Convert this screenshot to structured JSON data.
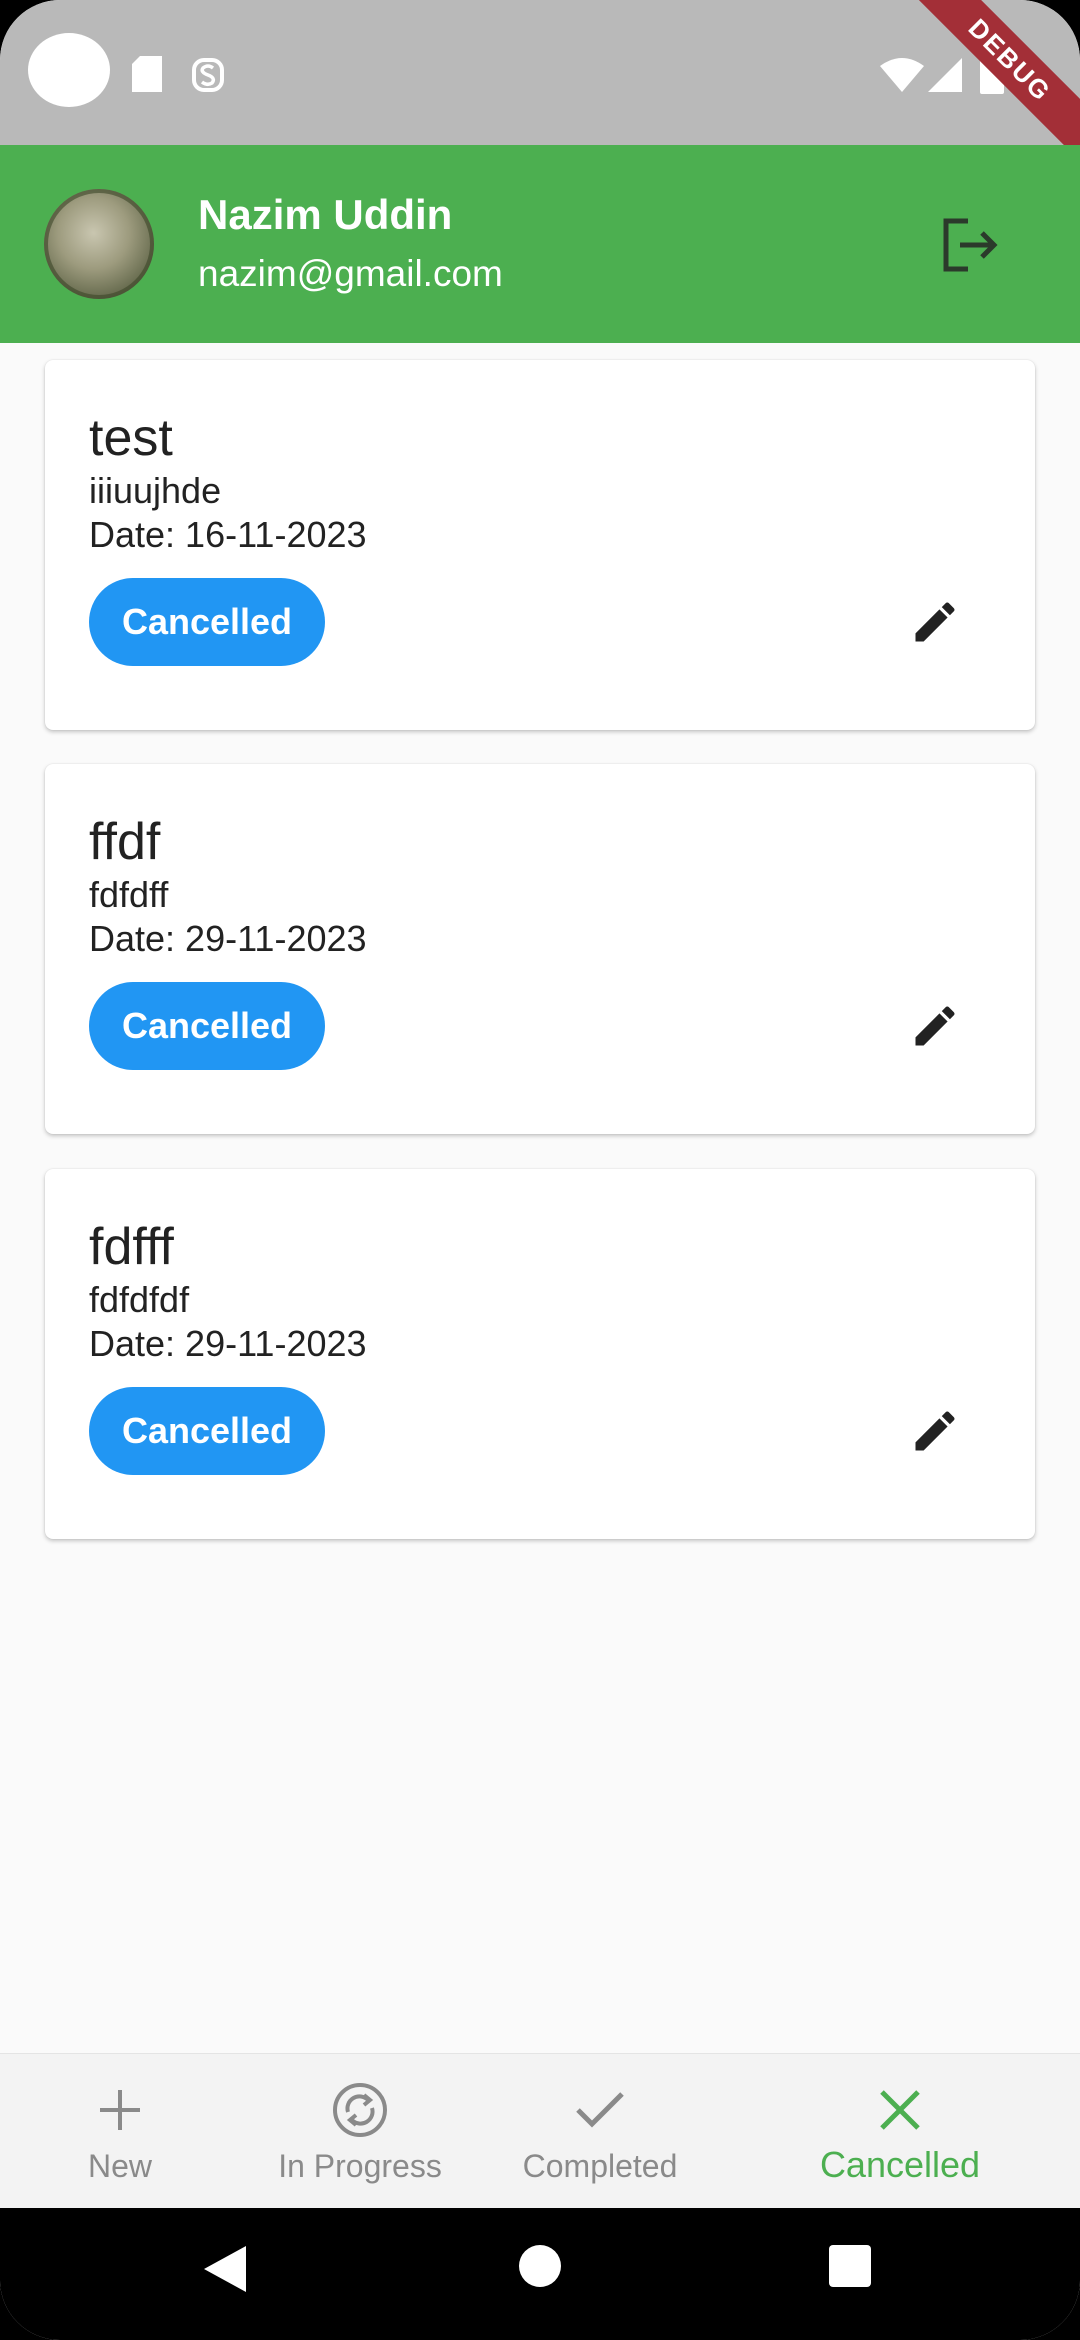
{
  "status_bar": {
    "icons": [
      "camera-cutout",
      "sd-card-icon",
      "s-badge-icon",
      "wifi-icon",
      "signal-icon",
      "battery-icon"
    ],
    "debug_banner": "DEBUG"
  },
  "header": {
    "user_name": "Nazim Uddin",
    "user_email": "nazim@gmail.com",
    "background": "#4caf50",
    "logout_icon": "logout-icon"
  },
  "tasks": [
    {
      "title": "test",
      "description": "iiiuujhde",
      "date": "Date: 16-11-2023",
      "status": "Cancelled"
    },
    {
      "title": "ffdf",
      "description": "fdfdff",
      "date": "Date: 29-11-2023",
      "status": "Cancelled"
    },
    {
      "title": "fdfff",
      "description": "fdfdfdf",
      "date": "Date: 29-11-2023",
      "status": "Cancelled"
    }
  ],
  "chip_color": "#2196f3",
  "bottom_nav": {
    "items": [
      {
        "label": "New",
        "icon": "plus-icon"
      },
      {
        "label": "In Progress",
        "icon": "sync-icon"
      },
      {
        "label": "Completed",
        "icon": "check-icon"
      },
      {
        "label": "Cancelled",
        "icon": "close-icon",
        "active": true
      }
    ],
    "active_color": "#4caf50"
  },
  "system_nav": {
    "buttons": [
      "back-icon",
      "home-icon",
      "recents-icon"
    ]
  }
}
